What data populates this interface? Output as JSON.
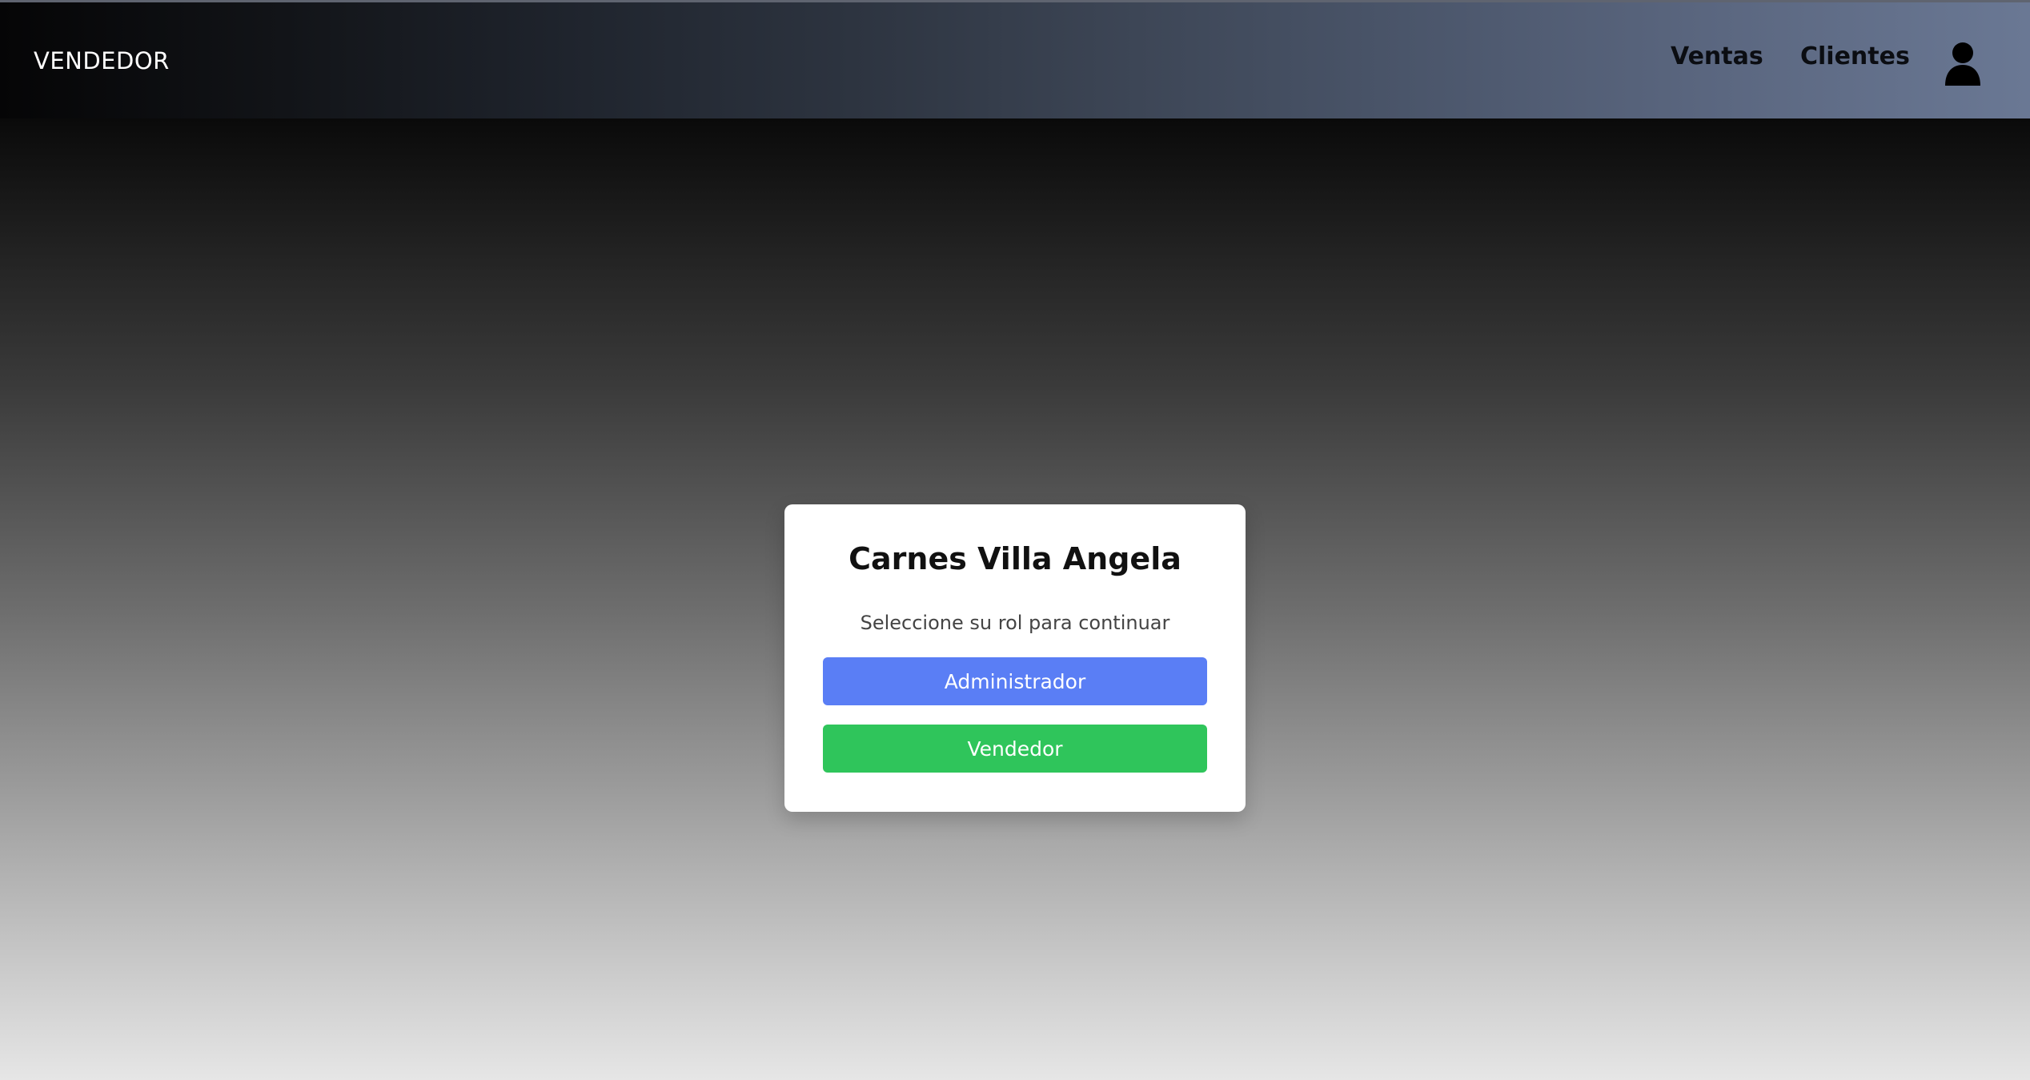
{
  "header": {
    "brand": "VENDEDOR",
    "nav": {
      "ventas": "Ventas",
      "clientes": "Clientes"
    },
    "user_icon": "user-icon"
  },
  "modal": {
    "title": "Carnes Villa Angela",
    "subtitle": "Seleccione su rol para continuar",
    "buttons": {
      "admin": "Administrador",
      "vendedor": "Vendedor"
    }
  },
  "colors": {
    "admin_button": "#5a7ef5",
    "vendedor_button": "#2fc55b"
  }
}
